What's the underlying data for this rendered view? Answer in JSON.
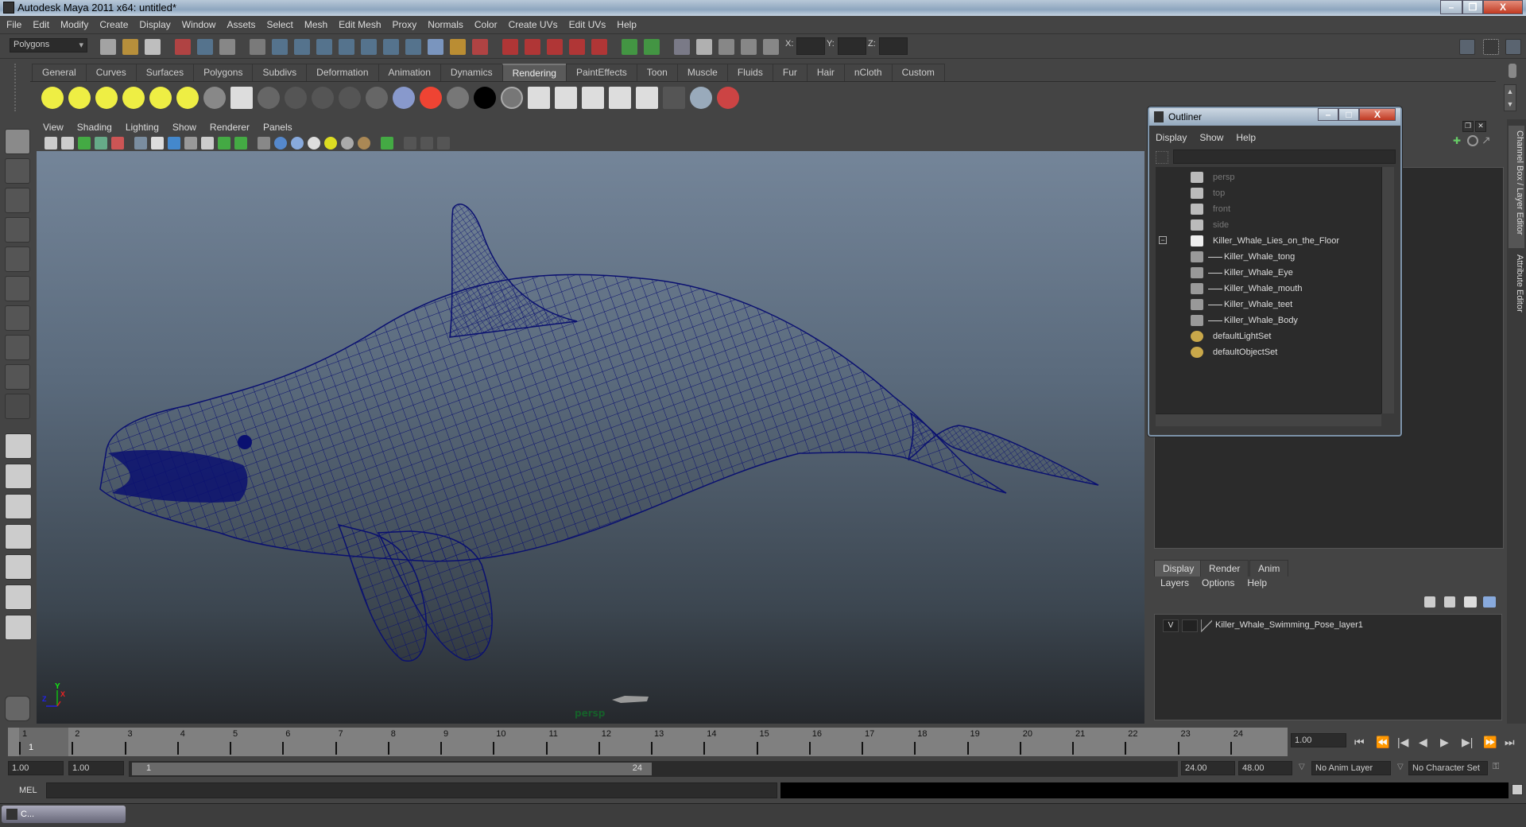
{
  "window": {
    "title": "Autodesk Maya 2011 x64: untitled*",
    "minimize": "–",
    "restore": "❐",
    "close": "X"
  },
  "menubar": [
    "File",
    "Edit",
    "Modify",
    "Create",
    "Display",
    "Window",
    "Assets",
    "Select",
    "Mesh",
    "Edit Mesh",
    "Proxy",
    "Normals",
    "Color",
    "Create UVs",
    "Edit UVs",
    "Help"
  ],
  "status_line": {
    "mode_selector": "Polygons",
    "x_label": "X:",
    "y_label": "Y:",
    "z_label": "Z:"
  },
  "shelf_tabs": [
    {
      "label": "General"
    },
    {
      "label": "Curves"
    },
    {
      "label": "Surfaces"
    },
    {
      "label": "Polygons"
    },
    {
      "label": "Subdivs"
    },
    {
      "label": "Deformation"
    },
    {
      "label": "Animation"
    },
    {
      "label": "Dynamics"
    },
    {
      "label": "Rendering",
      "active": true
    },
    {
      "label": "PaintEffects"
    },
    {
      "label": "Toon"
    },
    {
      "label": "Muscle"
    },
    {
      "label": "Fluids"
    },
    {
      "label": "Fur"
    },
    {
      "label": "Hair"
    },
    {
      "label": "nCloth"
    },
    {
      "label": "Custom"
    }
  ],
  "shelf_icons": [
    "ambient-light-icon",
    "directional-light-icon",
    "point-light-icon",
    "spot-light-icon",
    "area-light-icon",
    "volume-light-icon",
    "camera-icon",
    "hypershade-icon",
    "blinn-icon",
    "lambert-icon",
    "phong-icon",
    "phongE-icon",
    "anisotropic-icon",
    "layered-shader-icon",
    "ramp-shader-icon",
    "surface-shader-icon",
    "use-background-icon",
    "shading-map-icon",
    "render-view-icon",
    "ipr-render-icon",
    "batch-render-icon",
    "render-settings-icon",
    "render-layer-icon",
    "delete-render-icon",
    "texture-icon",
    "paint-icon"
  ],
  "panel_menu": [
    "View",
    "Shading",
    "Lighting",
    "Show",
    "Renderer",
    "Panels"
  ],
  "viewport": {
    "camera_label": "persp",
    "axis": {
      "x": "X",
      "y": "Y",
      "z": "Z"
    }
  },
  "outliner": {
    "title": "Outliner",
    "menu": [
      "Display",
      "Show",
      "Help"
    ],
    "items": [
      {
        "label": "persp",
        "type": "camera",
        "dimmed": true,
        "indent": 0
      },
      {
        "label": "top",
        "type": "camera",
        "dimmed": true,
        "indent": 0
      },
      {
        "label": "front",
        "type": "camera",
        "dimmed": true,
        "indent": 0
      },
      {
        "label": "side",
        "type": "camera",
        "dimmed": true,
        "indent": 0
      },
      {
        "label": "Killer_Whale_Lies_on_the_Floor",
        "type": "group",
        "expanded": true,
        "indent": 0
      },
      {
        "label": "Killer_Whale_tong",
        "type": "mesh",
        "indent": 1
      },
      {
        "label": "Killer_Whale_Eye",
        "type": "mesh",
        "indent": 1
      },
      {
        "label": "Killer_Whale_mouth",
        "type": "mesh",
        "indent": 1
      },
      {
        "label": "Killer_Whale_teet",
        "type": "mesh",
        "indent": 1
      },
      {
        "label": "Killer_Whale_Body",
        "type": "mesh",
        "indent": 1
      },
      {
        "label": "defaultLightSet",
        "type": "set",
        "indent": 0
      },
      {
        "label": "defaultObjectSet",
        "type": "set",
        "indent": 0
      }
    ]
  },
  "side_tabs": [
    "Channel Box / Layer Editor",
    "Attribute Editor"
  ],
  "layer_editor": {
    "tabs": [
      {
        "label": "Display",
        "active": true
      },
      {
        "label": "Render"
      },
      {
        "label": "Anim"
      }
    ],
    "menu": [
      "Layers",
      "Options",
      "Help"
    ],
    "layers": [
      {
        "visible": "V",
        "name": "Killer_Whale_Swimming_Pose_layer1"
      }
    ]
  },
  "timeline": {
    "ticks": [
      "1",
      "2",
      "3",
      "4",
      "5",
      "6",
      "7",
      "8",
      "9",
      "10",
      "11",
      "12",
      "13",
      "14",
      "15",
      "16",
      "17",
      "18",
      "19",
      "20",
      "21",
      "22",
      "23",
      "24"
    ],
    "current_frame": "1",
    "current_time_field": "1.00"
  },
  "playback_buttons": [
    "go-to-start-icon",
    "step-back-key-icon",
    "step-back-frame-icon",
    "play-backward-icon",
    "play-forward-icon",
    "step-forward-frame-icon",
    "step-forward-key-icon",
    "go-to-end-icon"
  ],
  "range": {
    "start": "1.00",
    "playback_start": "1.00",
    "slider_start": "1",
    "slider_end": "24",
    "playback_end": "24.00",
    "end": "48.00",
    "anim_layer": "No Anim Layer",
    "character_set": "No Character Set"
  },
  "command_line": {
    "label": "MEL"
  },
  "taskbar": {
    "item": "C..."
  }
}
